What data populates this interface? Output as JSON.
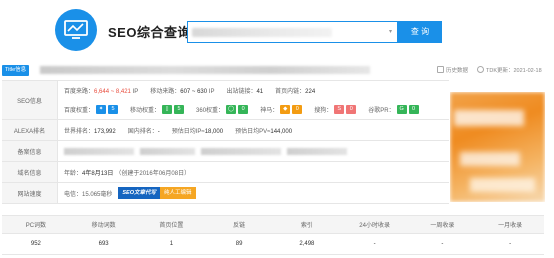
{
  "header": {
    "brand": "SEO综合查询",
    "search_caret": "▾",
    "search_button": "查 询"
  },
  "titlebar": {
    "tag": "Title信息",
    "history_label": "历史数据",
    "tdk_label": "TDK更新：2021-02-18"
  },
  "info": {
    "seo": {
      "label": "SEO信息",
      "line1": {
        "baidu_traffic_label": "百度来路：",
        "baidu_traffic_value": "6,644 ~ 8,421",
        "baidu_traffic_unit": "IP",
        "mobile_traffic_label": "移动来路：",
        "mobile_traffic_value": "607 ~ 630",
        "mobile_traffic_unit": "IP",
        "outlinks_label": "出站链接：",
        "outlinks_value": "41",
        "home_inlinks_label": "首页内链：",
        "home_inlinks_value": "224"
      },
      "line2": {
        "baidu_weight_label": "百度权重：",
        "baidu_weight_value": "5",
        "mobile_weight_label": "移动权重：",
        "mobile_weight_value": "5",
        "so360_label": "360权重：",
        "so360_value": "0",
        "shenma_label": "神马：",
        "shenma_value": "0",
        "sogou_label": "搜狗：",
        "sogou_value": "0",
        "google_label": "谷歌PR：",
        "google_value": "0"
      }
    },
    "alexa": {
      "label": "ALEXA排名",
      "world_rank_label": "世界排名：",
      "world_rank_value": "173,992",
      "domestic_rank_label": "国内排名：",
      "domestic_rank_value": "-",
      "daily_ip_label": "预估日均IP≈",
      "daily_ip_value": "18,000",
      "daily_pv_label": "预估日均PV≈",
      "daily_pv_value": "144,000"
    },
    "icp": {
      "label": "备案信息"
    },
    "domain": {
      "label": "域名信息",
      "age_label": "年龄：",
      "age_value": "4年8月13日",
      "created": "（创建于2016年06月08日）"
    },
    "speed": {
      "label": "网站速度",
      "telecom_label": "电信：",
      "telecom_value": "15.065毫秒",
      "seo_tag_a": "SEO文章代写",
      "seo_tag_b": "纯人工编辑"
    }
  },
  "stats": {
    "headers": [
      "PC词数",
      "移动词数",
      "首页位置",
      "反链",
      "索引",
      "24小时收录",
      "一周收录",
      "一月收录"
    ],
    "values": [
      "952",
      "693",
      "1",
      "89",
      "2,498",
      "-",
      "-",
      "-"
    ]
  },
  "colors": {
    "accent": "#1a90e8",
    "red": "#e84c3d",
    "green": "#35b558",
    "orange": "#f39c12"
  }
}
